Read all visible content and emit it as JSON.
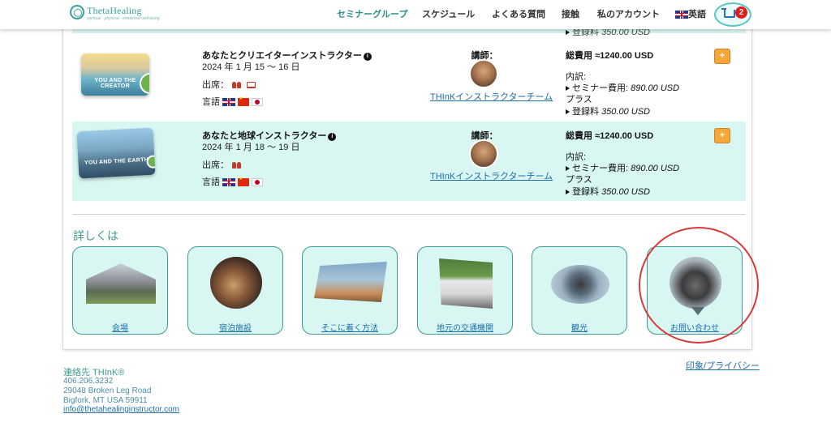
{
  "header": {
    "logo_text": "ThetaHealing",
    "logo_tagline": "spiritual · physical · emotional well-being",
    "nav": [
      {
        "label": "セミナーグループ"
      },
      {
        "label": "スケジュール"
      },
      {
        "label": "よくある質問"
      },
      {
        "label": "接触"
      },
      {
        "label": "私のアカウント"
      }
    ],
    "language_label": "英語",
    "cart_count": "2"
  },
  "top_row_partial": {
    "fee_label": "登録料",
    "fee_amount": "350.00 USD"
  },
  "courses": [
    {
      "title": "あなたとクリエイターインストラクター",
      "thumb_title": "YOU AND THE CREATOR",
      "date": "2024 年 1 月 15 ～ 16 日",
      "attendance_label": "出席：",
      "language_label": "言語",
      "instructor_label": "講師：",
      "instructor_link": "THInKインストラクターチーム",
      "total_label": "総費用",
      "total_value": "≈1240.00 USD",
      "breakdown_label": "内訳:",
      "seminar_label": "セミナー費用:",
      "seminar_amount": "890.00 USD",
      "plus_label": "プラス",
      "fee_label": "登録料",
      "fee_amount": "350.00 USD",
      "add_label": "+"
    },
    {
      "title": "あなたと地球インストラクター",
      "thumb_title": "YOU AND THE EARTH",
      "date": "2024 年 1 月 18 ～ 19 日",
      "attendance_label": "出席：",
      "language_label": "言語",
      "instructor_label": "講師：",
      "instructor_link": "THInKインストラクターチーム",
      "total_label": "総費用",
      "total_value": "≈1240.00 USD",
      "breakdown_label": "内訳:",
      "seminar_label": "セミナー費用:",
      "seminar_amount": "890.00 USD",
      "plus_label": "プラス",
      "fee_label": "登録料",
      "fee_amount": "350.00 USD",
      "add_label": "+"
    }
  ],
  "more_info": {
    "title": "詳しくは",
    "cards": [
      {
        "label": "会場"
      },
      {
        "label": "宿泊施設"
      },
      {
        "label": "そこに着く方法"
      },
      {
        "label": "地元の交通機関"
      },
      {
        "label": "観光"
      },
      {
        "label": "お問い合わせ"
      }
    ]
  },
  "footer": {
    "contact_title": "連絡先 THInK®",
    "phone": "406.206.3232",
    "address1": "29048 Broken Leg Road",
    "address2": "Bigfork, MT USA 59911",
    "email": "info@thetahealinginstructor.com",
    "privacy_link": "印象/プライバシー"
  },
  "colors": {
    "accent": "#3e9a94",
    "row_background": "#d8f7f2",
    "link": "#1e6ea8",
    "add_button": "#f6a73a",
    "highlight": "#d83a3a"
  }
}
